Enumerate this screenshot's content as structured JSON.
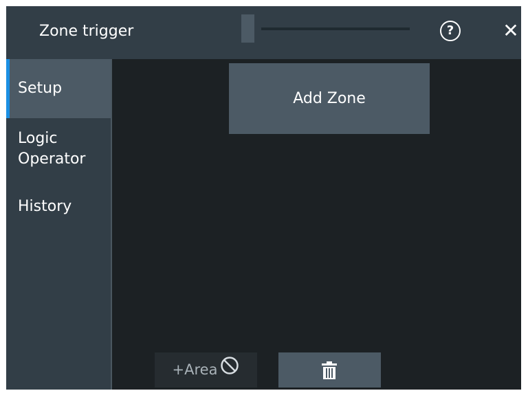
{
  "dialog": {
    "title": "Zone trigger",
    "help_icon": "question-circle-icon",
    "help_glyph": "?",
    "close_icon": "close-icon",
    "close_glyph": "✕"
  },
  "tabs": [
    {
      "label": "Setup",
      "active": true
    },
    {
      "label": "Logic Operator",
      "active": false
    },
    {
      "label": "History",
      "active": false
    }
  ],
  "main": {
    "add_zone_label": "Add Zone",
    "add_area_label": "+Area",
    "add_area_icon": "prohibited-icon",
    "delete_icon": "trash-icon"
  },
  "colors": {
    "accent": "#1a8fe3",
    "panel": "#323e47",
    "button": "#4c5a65",
    "background": "#1c2124"
  }
}
